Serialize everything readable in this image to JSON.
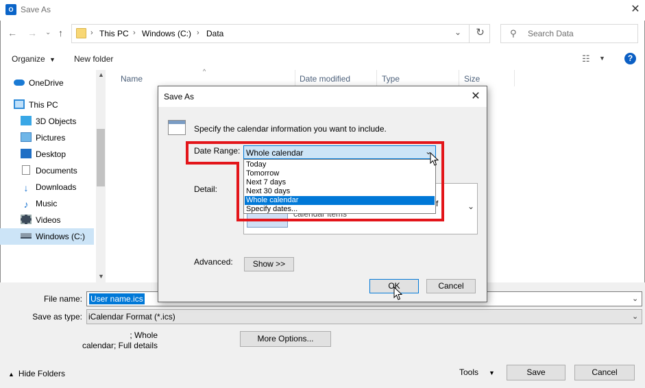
{
  "window": {
    "title": "Save As",
    "app_icon_text": "O",
    "close_glyph": "✕"
  },
  "address_bar": {
    "path": [
      "This PC",
      "Windows (C:)",
      "Data"
    ],
    "separator": "›"
  },
  "search": {
    "placeholder": "Search Data"
  },
  "toolbar": {
    "organize_label": "Organize",
    "new_folder_label": "New folder",
    "help_glyph": "?"
  },
  "columns": [
    "Name",
    "Date modified",
    "Type",
    "Size"
  ],
  "nav": {
    "items": [
      {
        "label": "OneDrive",
        "icon": "cloud-icon"
      },
      {
        "label": "This PC",
        "icon": "computer-icon"
      },
      {
        "label": "3D Objects",
        "icon": "cube-icon"
      },
      {
        "label": "Pictures",
        "icon": "pictures-icon"
      },
      {
        "label": "Desktop",
        "icon": "desktop-icon"
      },
      {
        "label": "Documents",
        "icon": "document-icon"
      },
      {
        "label": "Downloads",
        "icon": "download-icon"
      },
      {
        "label": "Music",
        "icon": "music-icon"
      },
      {
        "label": "Videos",
        "icon": "video-icon"
      },
      {
        "label": "Windows (C:)",
        "icon": "drive-icon"
      }
    ],
    "selected": "Windows (C:)"
  },
  "bottom": {
    "file_name_label": "File name:",
    "file_name_value": "User name.ics",
    "save_type_label": "Save as type:",
    "save_type_value": "iCalendar Format (*.ics)",
    "summary_line1": "; Whole",
    "summary_line2": "calendar; Full details",
    "more_options_label": "More Options...",
    "hide_folders_label": "Hide Folders",
    "tools_label": "Tools",
    "save_label": "Save",
    "cancel_label": "Cancel"
  },
  "dialog": {
    "title": "Save As",
    "close_glyph": "✕",
    "instruction": "Specify the calendar information you want to include.",
    "date_range_label": "Date Range:",
    "date_range_value": "Whole calendar",
    "date_range_options": [
      "Today",
      "Tomorrow",
      "Next 7 days",
      "Next 30 days",
      "Whole calendar",
      "Specify dates..."
    ],
    "selected_option_index": 4,
    "detail_label": "Detail:",
    "detail_partial_text": "calendar items",
    "detail_partial_text2": "f",
    "advanced_label": "Advanced:",
    "show_button_label": "Show >>",
    "ok_label": "OK",
    "cancel_label": "Cancel"
  },
  "colors": {
    "accent": "#0078d7",
    "highlight": "#e3151a",
    "selection_bg": "#cce4f7"
  }
}
